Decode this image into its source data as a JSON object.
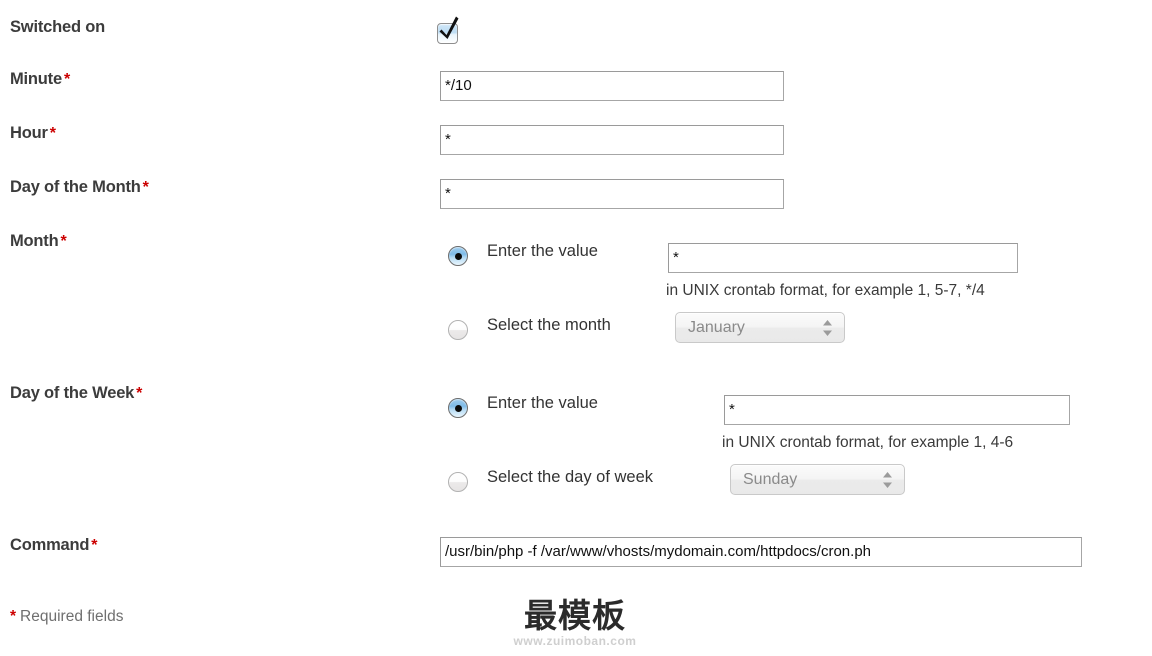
{
  "form": {
    "switched_on": {
      "label": "Switched on",
      "checkbox_checked": true,
      "icon": "check-icon"
    },
    "minute": {
      "label": "Minute",
      "required_marker": "*",
      "value": "*/10"
    },
    "hour": {
      "label": "Hour",
      "required_marker": "*",
      "value": "*"
    },
    "day_of_month": {
      "label": "Day of the Month",
      "required_marker": "*",
      "value": "*"
    },
    "month": {
      "label": "Month",
      "required_marker": "*",
      "enter_value_option": "Enter the value",
      "enter_value_selected": true,
      "value": "*",
      "hint": "in UNIX crontab format, for example 1, 5-7, */4",
      "select_option": "Select the month",
      "select_selected": false,
      "select_value": "January"
    },
    "day_of_week": {
      "label": "Day of the Week",
      "required_marker": "*",
      "enter_value_option": "Enter the value",
      "enter_value_selected": true,
      "value": "*",
      "hint": "in UNIX crontab format, for example 1, 4-6",
      "select_option": "Select the day of week",
      "select_selected": false,
      "select_value": "Sunday"
    },
    "command": {
      "label": "Command",
      "required_marker": "*",
      "value": "/usr/bin/php -f /var/www/vhosts/mydomain.com/httpdocs/cron.ph"
    },
    "footer": {
      "required_star": "*",
      "required_text": "Required fields"
    }
  },
  "watermark": {
    "title": "最模板",
    "url": "www.zuimoban.com"
  },
  "colors": {
    "label": "#3c3c3c",
    "required": "#cc0000",
    "input_border": "#9a9a9a",
    "hint": "#3a3a3a",
    "select_text": "#8a8a8a",
    "checkbox_accent": "#bcdcf3",
    "radio_accent": "#7fbbe8"
  }
}
